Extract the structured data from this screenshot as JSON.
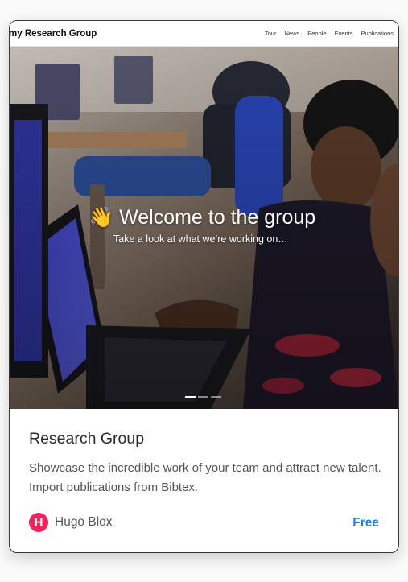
{
  "site": {
    "brand": "my Research Group",
    "nav": [
      "Tour",
      "News",
      "People",
      "Events",
      "Publications"
    ]
  },
  "hero": {
    "emoji": "👋",
    "title": "Welcome to the group",
    "subtitle": "Take a look at what we’re working on…",
    "carousel_slides": 3,
    "active_slide": 1
  },
  "card": {
    "title": "Research Group",
    "description": "Showcase the incredible work of your team and attract new talent. Import publications from Bibtex.",
    "author": "Hugo Blox",
    "author_logo_letter": "H",
    "price": "Free"
  },
  "colors": {
    "price": "#1a7fe0",
    "logo": "#f0245c",
    "card_border": "#3a3a3a"
  }
}
